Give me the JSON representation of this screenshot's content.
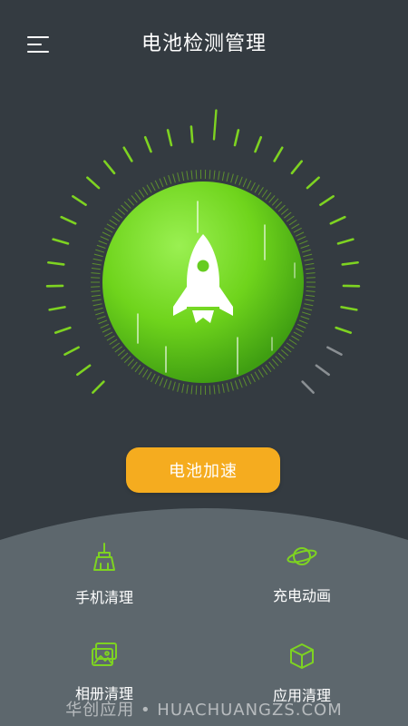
{
  "header": {
    "title": "电池检测管理",
    "menu_icon": "hamburger-menu-icon"
  },
  "gauge": {
    "center_icon": "rocket-icon",
    "accent_color": "#7ed321",
    "inactive_color": "#8a8f93",
    "active_fraction": 0.92
  },
  "actions": {
    "boost_label": "电池加速",
    "boost_color": "#f5ac1f"
  },
  "features": [
    {
      "label": "手机清理",
      "icon": "broom-icon"
    },
    {
      "label": "充电动画",
      "icon": "planet-icon"
    },
    {
      "label": "相册清理",
      "icon": "gallery-icon"
    },
    {
      "label": "应用清理",
      "icon": "cube-icon"
    }
  ],
  "watermark": "华创应用 • HUACHUANGZS.COM"
}
